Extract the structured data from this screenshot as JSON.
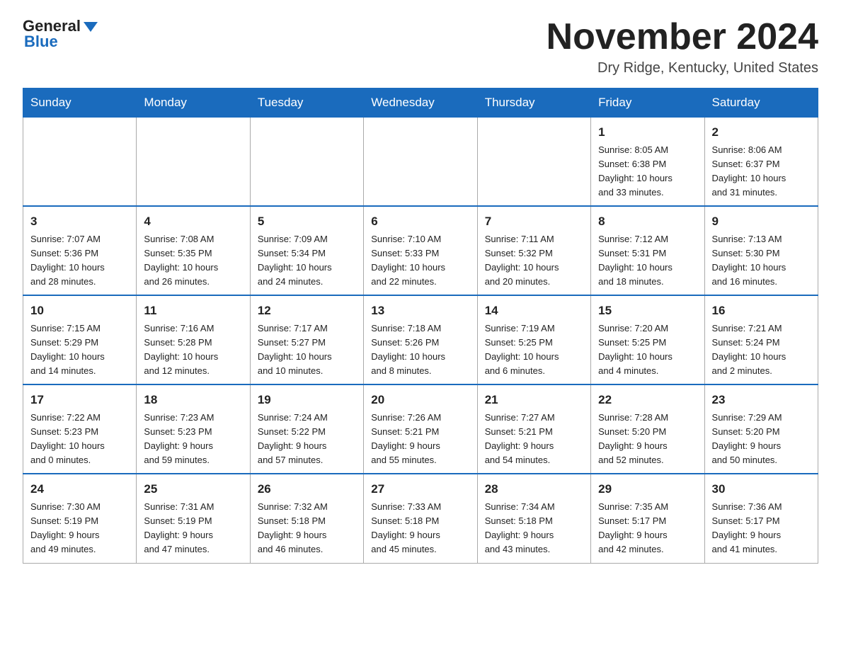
{
  "header": {
    "logo_general": "General",
    "logo_blue": "Blue",
    "month_title": "November 2024",
    "location": "Dry Ridge, Kentucky, United States"
  },
  "days_of_week": [
    "Sunday",
    "Monday",
    "Tuesday",
    "Wednesday",
    "Thursday",
    "Friday",
    "Saturday"
  ],
  "weeks": [
    [
      {
        "day": "",
        "info": ""
      },
      {
        "day": "",
        "info": ""
      },
      {
        "day": "",
        "info": ""
      },
      {
        "day": "",
        "info": ""
      },
      {
        "day": "",
        "info": ""
      },
      {
        "day": "1",
        "info": "Sunrise: 8:05 AM\nSunset: 6:38 PM\nDaylight: 10 hours\nand 33 minutes."
      },
      {
        "day": "2",
        "info": "Sunrise: 8:06 AM\nSunset: 6:37 PM\nDaylight: 10 hours\nand 31 minutes."
      }
    ],
    [
      {
        "day": "3",
        "info": "Sunrise: 7:07 AM\nSunset: 5:36 PM\nDaylight: 10 hours\nand 28 minutes."
      },
      {
        "day": "4",
        "info": "Sunrise: 7:08 AM\nSunset: 5:35 PM\nDaylight: 10 hours\nand 26 minutes."
      },
      {
        "day": "5",
        "info": "Sunrise: 7:09 AM\nSunset: 5:34 PM\nDaylight: 10 hours\nand 24 minutes."
      },
      {
        "day": "6",
        "info": "Sunrise: 7:10 AM\nSunset: 5:33 PM\nDaylight: 10 hours\nand 22 minutes."
      },
      {
        "day": "7",
        "info": "Sunrise: 7:11 AM\nSunset: 5:32 PM\nDaylight: 10 hours\nand 20 minutes."
      },
      {
        "day": "8",
        "info": "Sunrise: 7:12 AM\nSunset: 5:31 PM\nDaylight: 10 hours\nand 18 minutes."
      },
      {
        "day": "9",
        "info": "Sunrise: 7:13 AM\nSunset: 5:30 PM\nDaylight: 10 hours\nand 16 minutes."
      }
    ],
    [
      {
        "day": "10",
        "info": "Sunrise: 7:15 AM\nSunset: 5:29 PM\nDaylight: 10 hours\nand 14 minutes."
      },
      {
        "day": "11",
        "info": "Sunrise: 7:16 AM\nSunset: 5:28 PM\nDaylight: 10 hours\nand 12 minutes."
      },
      {
        "day": "12",
        "info": "Sunrise: 7:17 AM\nSunset: 5:27 PM\nDaylight: 10 hours\nand 10 minutes."
      },
      {
        "day": "13",
        "info": "Sunrise: 7:18 AM\nSunset: 5:26 PM\nDaylight: 10 hours\nand 8 minutes."
      },
      {
        "day": "14",
        "info": "Sunrise: 7:19 AM\nSunset: 5:25 PM\nDaylight: 10 hours\nand 6 minutes."
      },
      {
        "day": "15",
        "info": "Sunrise: 7:20 AM\nSunset: 5:25 PM\nDaylight: 10 hours\nand 4 minutes."
      },
      {
        "day": "16",
        "info": "Sunrise: 7:21 AM\nSunset: 5:24 PM\nDaylight: 10 hours\nand 2 minutes."
      }
    ],
    [
      {
        "day": "17",
        "info": "Sunrise: 7:22 AM\nSunset: 5:23 PM\nDaylight: 10 hours\nand 0 minutes."
      },
      {
        "day": "18",
        "info": "Sunrise: 7:23 AM\nSunset: 5:23 PM\nDaylight: 9 hours\nand 59 minutes."
      },
      {
        "day": "19",
        "info": "Sunrise: 7:24 AM\nSunset: 5:22 PM\nDaylight: 9 hours\nand 57 minutes."
      },
      {
        "day": "20",
        "info": "Sunrise: 7:26 AM\nSunset: 5:21 PM\nDaylight: 9 hours\nand 55 minutes."
      },
      {
        "day": "21",
        "info": "Sunrise: 7:27 AM\nSunset: 5:21 PM\nDaylight: 9 hours\nand 54 minutes."
      },
      {
        "day": "22",
        "info": "Sunrise: 7:28 AM\nSunset: 5:20 PM\nDaylight: 9 hours\nand 52 minutes."
      },
      {
        "day": "23",
        "info": "Sunrise: 7:29 AM\nSunset: 5:20 PM\nDaylight: 9 hours\nand 50 minutes."
      }
    ],
    [
      {
        "day": "24",
        "info": "Sunrise: 7:30 AM\nSunset: 5:19 PM\nDaylight: 9 hours\nand 49 minutes."
      },
      {
        "day": "25",
        "info": "Sunrise: 7:31 AM\nSunset: 5:19 PM\nDaylight: 9 hours\nand 47 minutes."
      },
      {
        "day": "26",
        "info": "Sunrise: 7:32 AM\nSunset: 5:18 PM\nDaylight: 9 hours\nand 46 minutes."
      },
      {
        "day": "27",
        "info": "Sunrise: 7:33 AM\nSunset: 5:18 PM\nDaylight: 9 hours\nand 45 minutes."
      },
      {
        "day": "28",
        "info": "Sunrise: 7:34 AM\nSunset: 5:18 PM\nDaylight: 9 hours\nand 43 minutes."
      },
      {
        "day": "29",
        "info": "Sunrise: 7:35 AM\nSunset: 5:17 PM\nDaylight: 9 hours\nand 42 minutes."
      },
      {
        "day": "30",
        "info": "Sunrise: 7:36 AM\nSunset: 5:17 PM\nDaylight: 9 hours\nand 41 minutes."
      }
    ]
  ]
}
